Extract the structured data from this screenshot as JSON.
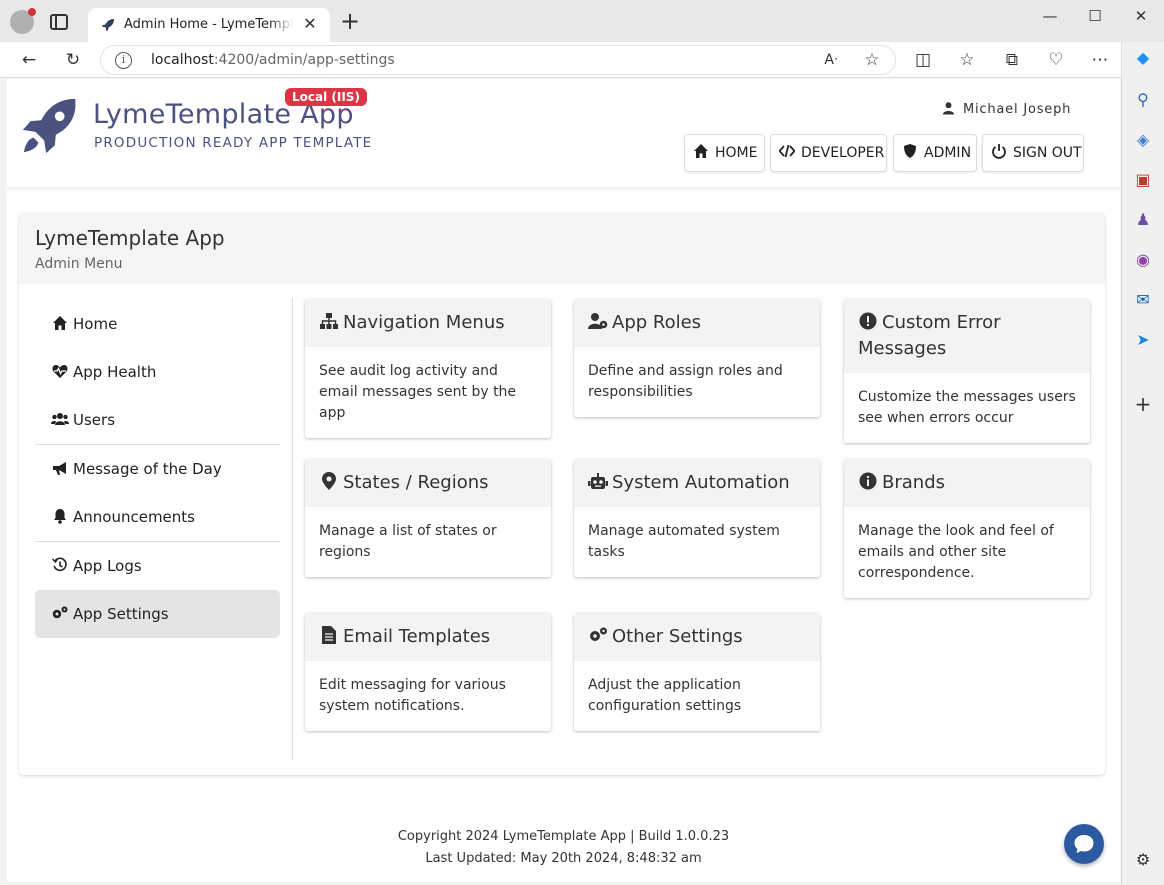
{
  "browser": {
    "tab_title": "Admin Home - LymeTemplate App",
    "url_host": "localhost",
    "url_path": ":4200/admin/app-settings",
    "minimize": "—",
    "maximize": "☐",
    "close": "✕"
  },
  "header": {
    "brand_name": "LymeTemplate App",
    "env_badge": "Local (IIS)",
    "tagline": "PRODUCTION READY APP TEMPLATE",
    "user_name": "Michael Joseph",
    "nav": [
      {
        "label": "HOME",
        "icon": "home-icon"
      },
      {
        "label": "DEVELOPER",
        "icon": "code-icon"
      },
      {
        "label": "ADMIN",
        "icon": "shield-icon"
      },
      {
        "label": "SIGN OUT",
        "icon": "power-icon"
      }
    ]
  },
  "card": {
    "title": "LymeTemplate App",
    "subtitle": "Admin Menu"
  },
  "menu": [
    {
      "label": "Home",
      "icon": "home-icon"
    },
    {
      "label": "App Health",
      "icon": "heart-pulse-icon"
    },
    {
      "label": "Users",
      "icon": "users-icon"
    },
    {
      "label": "Message of the Day",
      "icon": "bullhorn-icon"
    },
    {
      "label": "Announcements",
      "icon": "bell-icon"
    },
    {
      "label": "App Logs",
      "icon": "history-icon"
    },
    {
      "label": "App Settings",
      "icon": "gears-icon",
      "active": true
    }
  ],
  "tiles": [
    {
      "title": "Navigation Menus",
      "desc": "See audit log activity and email messages sent by the app",
      "icon": "sitemap-icon"
    },
    {
      "title": "App Roles",
      "desc": "Define and assign roles and responsibilities",
      "icon": "user-gear-icon"
    },
    {
      "title": "Custom Error Messages",
      "desc": "Customize the messages users see when errors occur",
      "icon": "exclamation-circle-icon"
    },
    {
      "title": "States / Regions",
      "desc": "Manage a list of states or regions",
      "icon": "map-marker-icon"
    },
    {
      "title": "System Automation",
      "desc": "Manage automated system tasks",
      "icon": "robot-icon"
    },
    {
      "title": "Brands",
      "desc": "Manage the look and feel of emails and other site correspondence.",
      "icon": "info-circle-icon"
    },
    {
      "title": "Email Templates",
      "desc": "Edit messaging for various system notifications.",
      "icon": "file-text-icon"
    },
    {
      "title": "Other Settings",
      "desc": "Adjust the application configuration settings",
      "icon": "gears-icon"
    }
  ],
  "footer": {
    "copyright": "Copyright 2024 LymeTemplate App | Build 1.0.0.23",
    "updated": "Last Updated: May 20th 2024, 8:48:32 am"
  },
  "colors": {
    "brand": "#4b5280",
    "badge": "#dc3545",
    "chat": "#2c5aa0"
  }
}
